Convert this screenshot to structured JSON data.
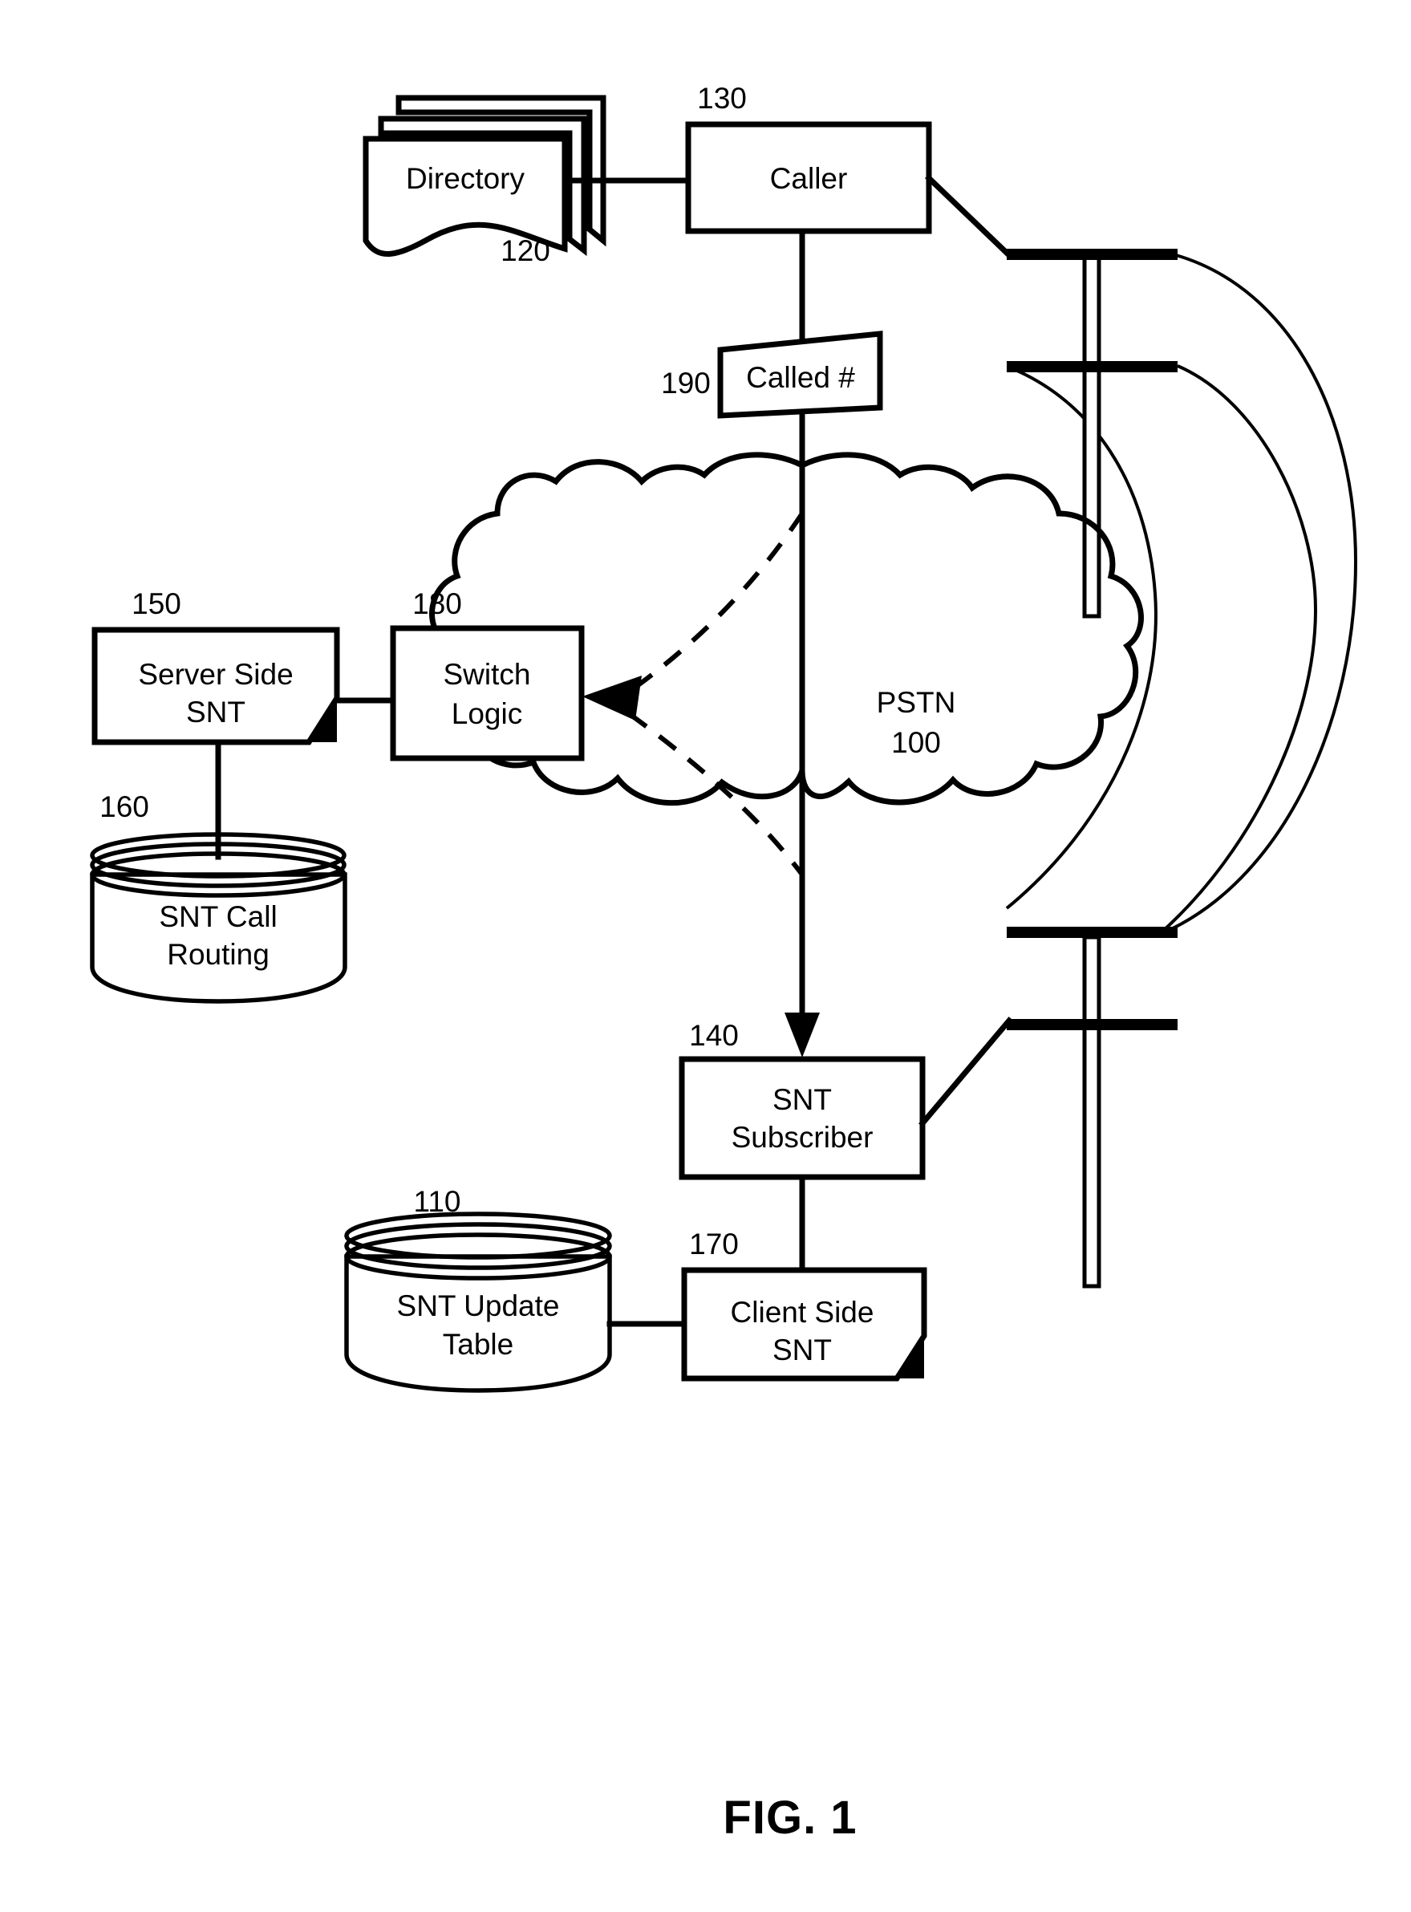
{
  "figure": {
    "caption": "FIG. 1",
    "title": "FIG. 1"
  },
  "nodes": {
    "directory": {
      "ref": "120",
      "label": "Directory",
      "shape": "stacked-document"
    },
    "caller": {
      "ref": "130",
      "label": "Caller",
      "shape": "rectangle"
    },
    "called_number": {
      "ref": "190",
      "label": "Called #",
      "shape": "parallelogram"
    },
    "pstn": {
      "ref": "100",
      "label": "PSTN",
      "shape": "cloud"
    },
    "server_side_snt": {
      "ref": "150",
      "label_line1": "Server Side",
      "label_line2": "SNT",
      "shape": "rectangle-folded-corner"
    },
    "switch_logic": {
      "ref": "180",
      "label_line1": "Switch",
      "label_line2": "Logic",
      "shape": "rectangle"
    },
    "snt_call_routing": {
      "ref": "160",
      "label_line1": "SNT Call",
      "label_line2": "Routing",
      "shape": "database-cylinder"
    },
    "snt_subscriber": {
      "ref": "140",
      "label_line1": "SNT",
      "label_line2": "Subscriber",
      "shape": "rectangle"
    },
    "client_side_snt": {
      "ref": "170",
      "label_line1": "Client Side",
      "label_line2": "SNT",
      "shape": "rectangle-folded-corner"
    },
    "snt_update_table": {
      "ref": "110",
      "label_line1": "SNT Update",
      "label_line2": "Table",
      "shape": "database-cylinder"
    }
  },
  "decorations": {
    "upper_pole": "telephone-pole",
    "lower_pole": "telephone-pole",
    "wires": "three-curved-wires"
  },
  "colors": {
    "ink": "#000000",
    "paper": "#ffffff"
  }
}
